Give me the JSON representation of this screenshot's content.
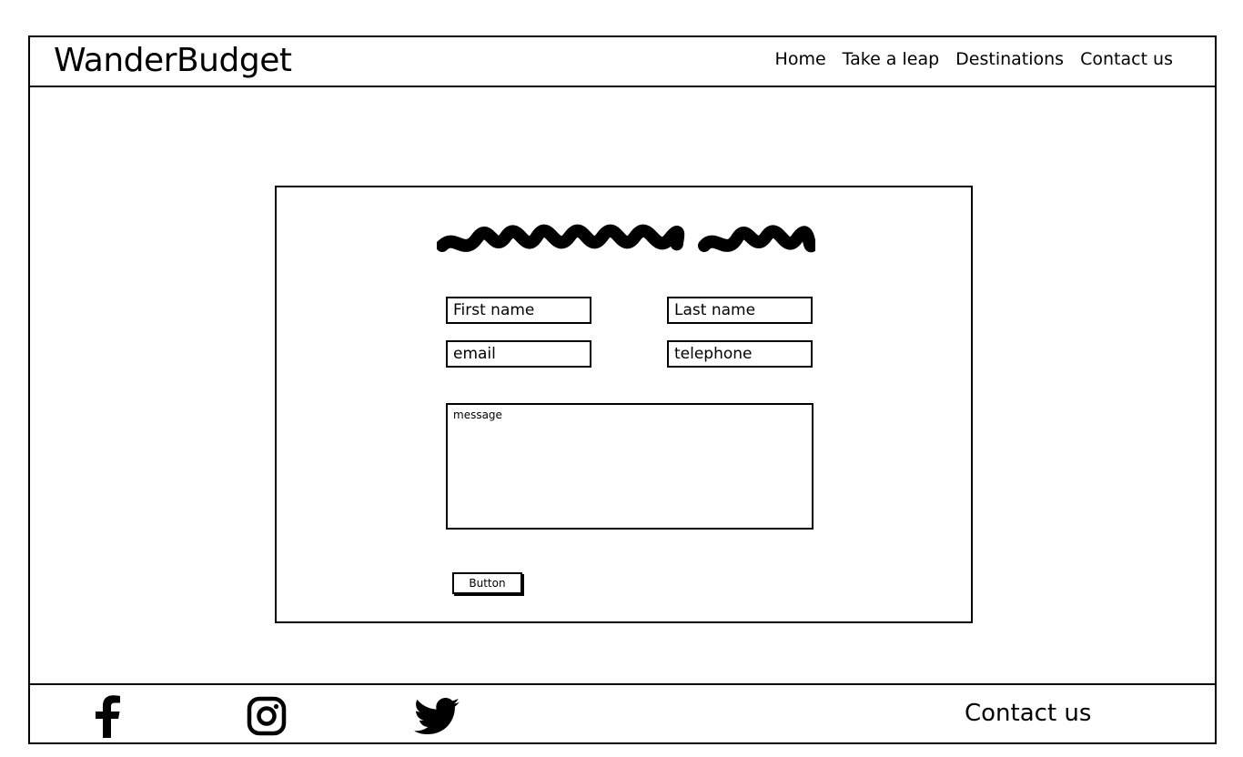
{
  "site": {
    "logo": "WanderBudget"
  },
  "nav": {
    "items": [
      "Home",
      "Take a leap",
      "Destinations",
      "Contact us"
    ]
  },
  "form": {
    "first_name_placeholder": "First name",
    "last_name_placeholder": "Last name",
    "email_placeholder": "email",
    "telephone_placeholder": "telephone",
    "message_placeholder": "message",
    "button_label": "Button"
  },
  "footer": {
    "social_icons": [
      "facebook-icon",
      "instagram-icon",
      "twitter-icon"
    ],
    "contact_label": "Contact us"
  }
}
